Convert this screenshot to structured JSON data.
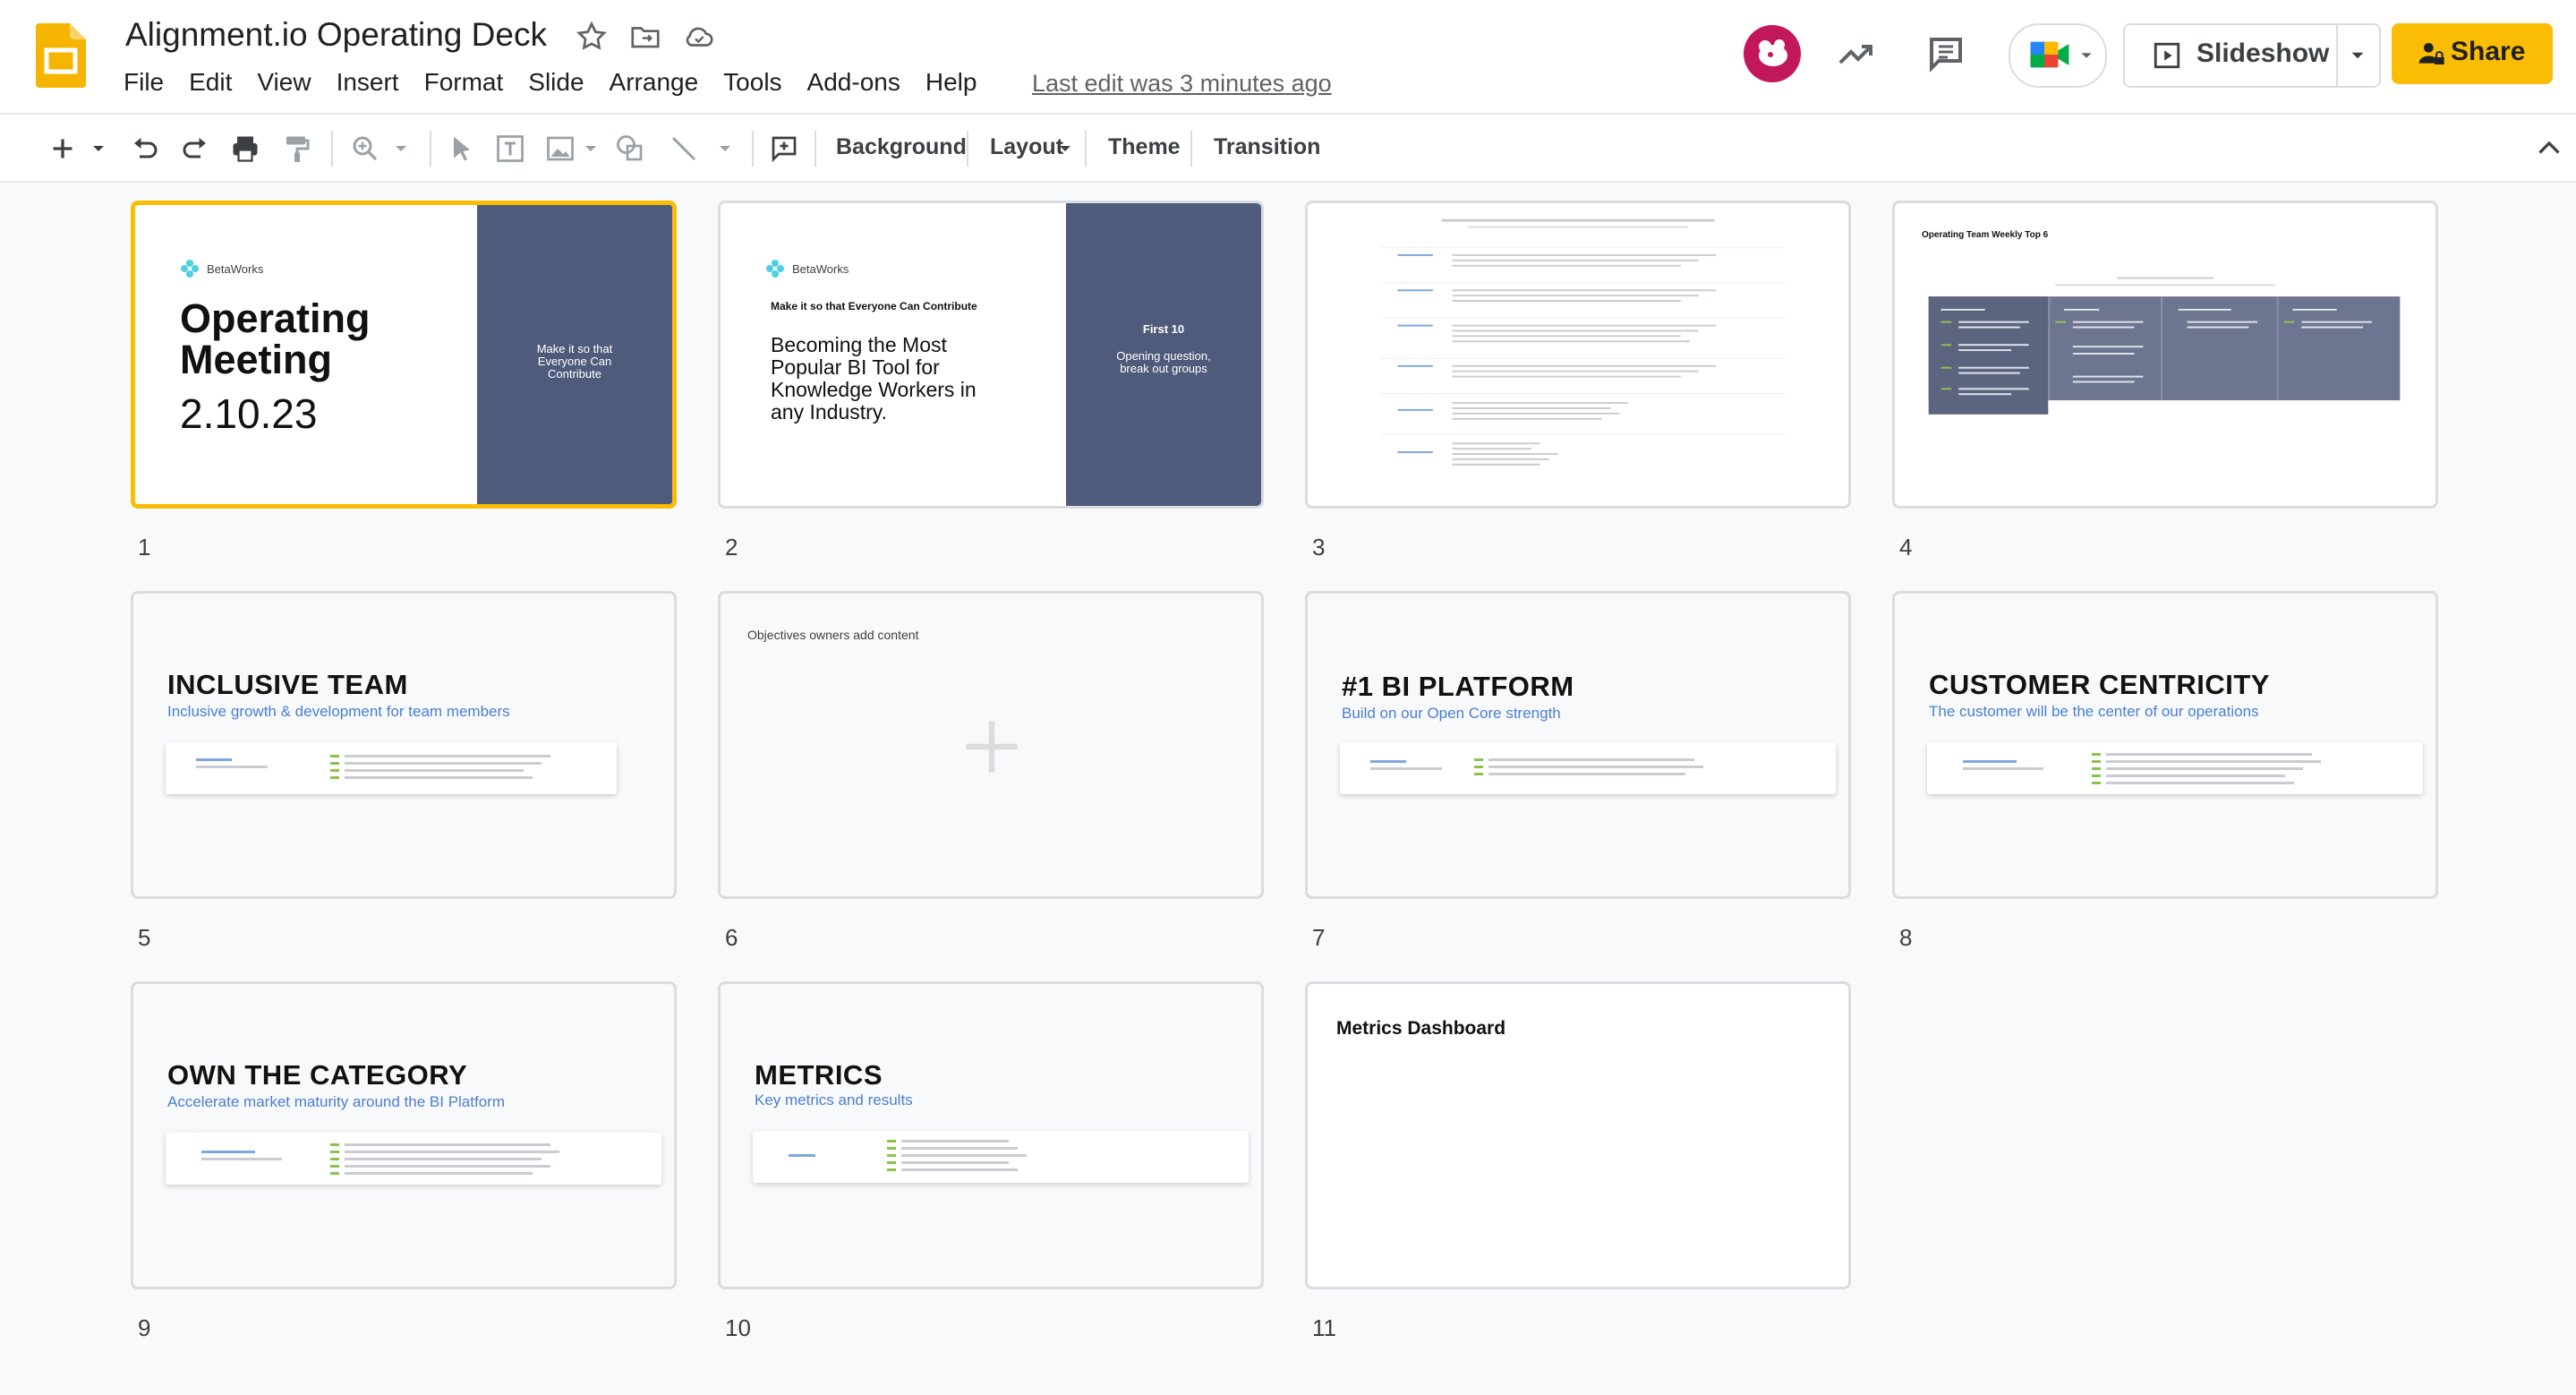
{
  "header": {
    "doc_title": "Alignment.io Operating Deck",
    "menu": [
      "File",
      "Edit",
      "View",
      "Insert",
      "Format",
      "Slide",
      "Arrange",
      "Tools",
      "Add-ons",
      "Help"
    ],
    "last_edit": "Last edit was 3 minutes ago",
    "slideshow_label": "Slideshow",
    "share_label": "Share"
  },
  "toolbar": {
    "background": "Background",
    "layout": "Layout",
    "theme": "Theme",
    "transition": "Transition"
  },
  "slides": [
    {
      "n": "1",
      "brand": "BetaWorks",
      "title_line1": "Operating",
      "title_line2": "Meeting",
      "date": "2.10.23",
      "panel_line1": "Make it so that",
      "panel_line2": "Everyone Can",
      "panel_line3": "Contribute"
    },
    {
      "n": "2",
      "brand": "BetaWorks",
      "heading": "Make it so that Everyone Can Contribute",
      "body_line1": "Becoming the Most",
      "body_line2": "Popular BI Tool for",
      "body_line3": "Knowledge Workers in",
      "body_line4": "any Industry.",
      "panel_title": "First 10",
      "panel_line1": "Opening question,",
      "panel_line2": "break out groups"
    },
    {
      "n": "3"
    },
    {
      "n": "4",
      "heading": "Operating Team Weekly Top 6"
    },
    {
      "n": "5",
      "title": "INCLUSIVE TEAM",
      "subtitle": "Inclusive growth & development for team members"
    },
    {
      "n": "6",
      "caption": "Objectives owners add content"
    },
    {
      "n": "7",
      "title": "#1 BI PLATFORM",
      "subtitle": "Build on our Open Core strength"
    },
    {
      "n": "8",
      "title": "CUSTOMER CENTRICITY",
      "subtitle": "The customer will be the center of our operations"
    },
    {
      "n": "9",
      "title": "OWN THE CATEGORY",
      "subtitle": "Accelerate market maturity around the BI Platform"
    },
    {
      "n": "10",
      "title": "METRICS",
      "subtitle": "Key metrics and results"
    },
    {
      "n": "11",
      "heading": "Metrics Dashboard"
    }
  ],
  "colors": {
    "accent": "#fbbc04",
    "navy_panel": "#4f5b7b",
    "subtitle_blue": "#4a7fd3"
  }
}
